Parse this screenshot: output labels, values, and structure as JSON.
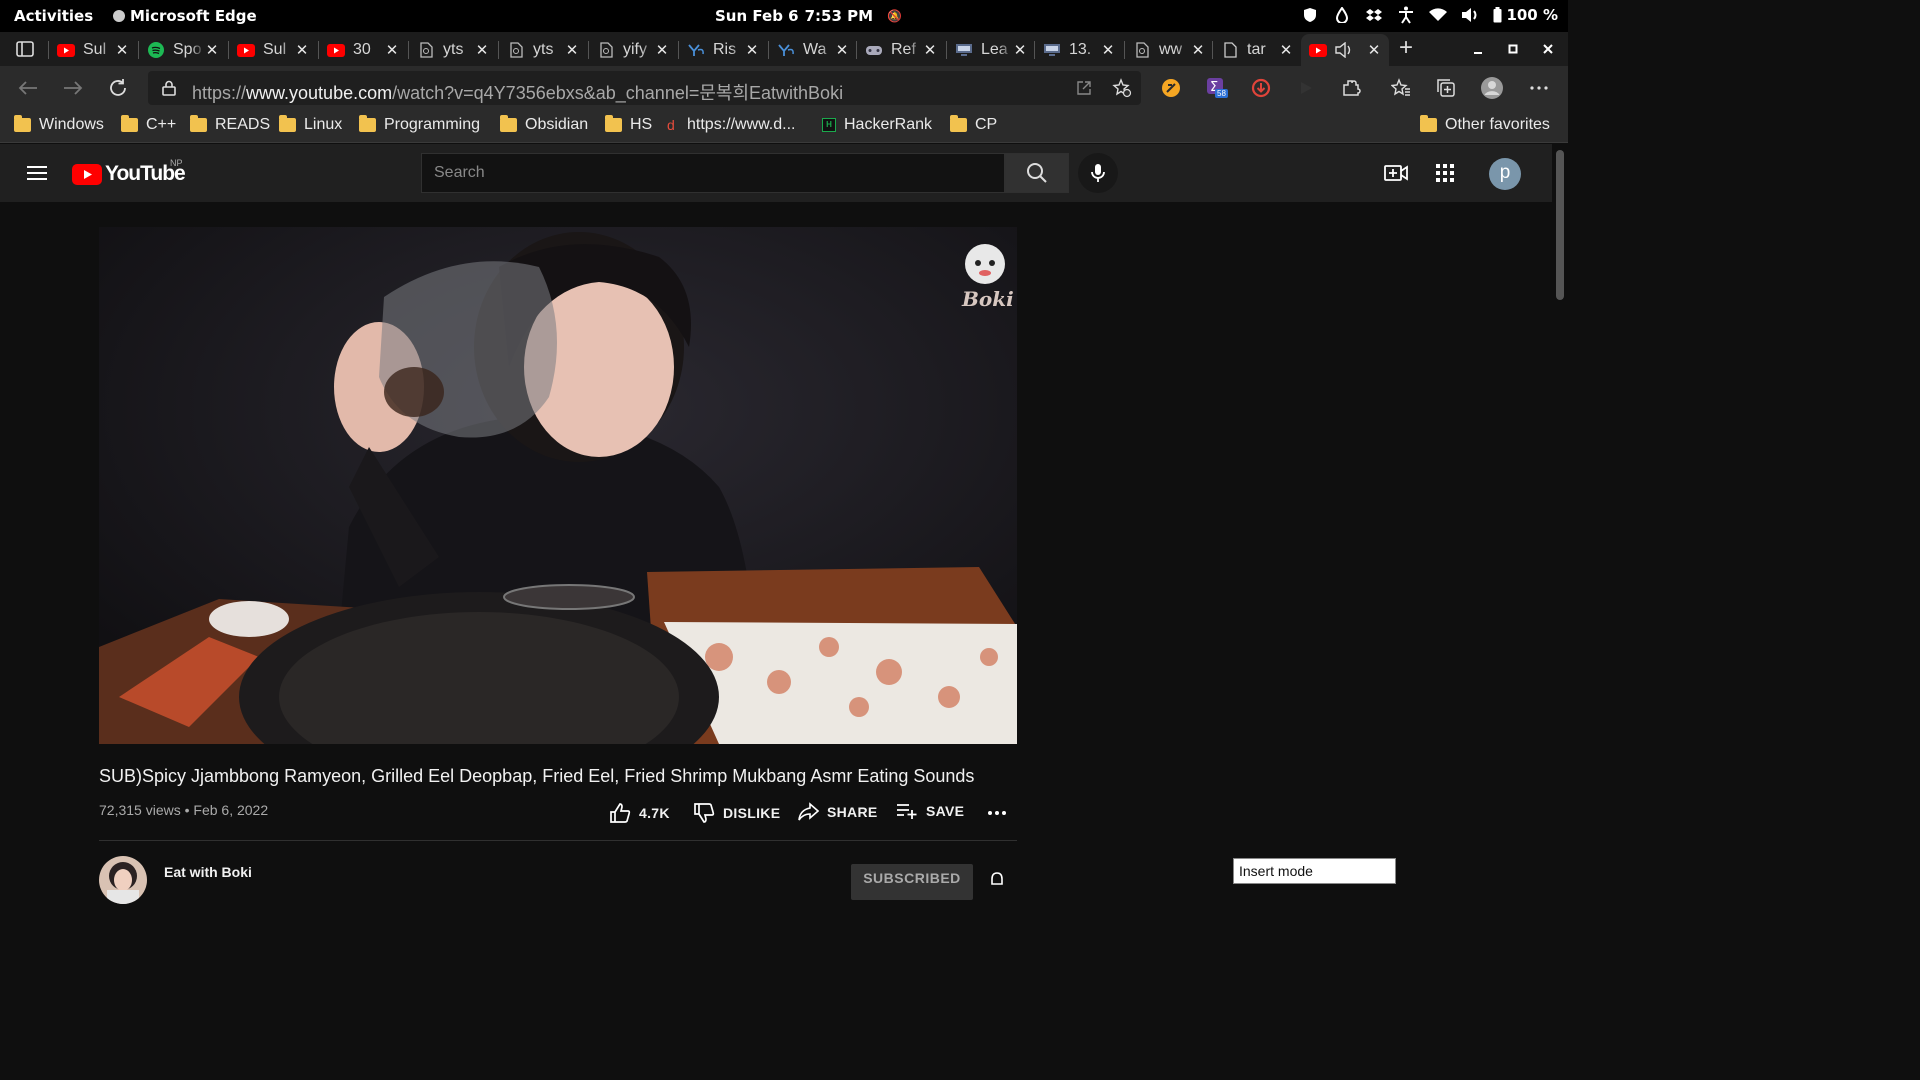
{
  "gnome": {
    "activities": "Activities",
    "app_name": "Microsoft Edge",
    "date": "Sun Feb 6",
    "time": "7:53 PM",
    "battery": "100 %"
  },
  "tabs": [
    {
      "label": "Sul",
      "favicon": "youtube-icon"
    },
    {
      "label": "Spo",
      "favicon": "spotify-icon"
    },
    {
      "label": "Sul",
      "favicon": "youtube-icon"
    },
    {
      "label": "30",
      "favicon": "youtube-icon"
    },
    {
      "label": "yts",
      "favicon": "page-icon"
    },
    {
      "label": "yts",
      "favicon": "page-icon"
    },
    {
      "label": "yify",
      "favicon": "page-icon"
    },
    {
      "label": "Ris",
      "favicon": "yc-icon"
    },
    {
      "label": "Wa",
      "favicon": "yc-icon"
    },
    {
      "label": "Ref",
      "favicon": "gamepad-icon"
    },
    {
      "label": "Lea",
      "favicon": "monitor-icon"
    },
    {
      "label": "13.",
      "favicon": "monitor-icon"
    },
    {
      "label": "ww",
      "favicon": "page-icon"
    },
    {
      "label": "tar",
      "favicon": "document-icon"
    }
  ],
  "address_bar": {
    "url_prefix": "https://",
    "url_domain": "www.youtube.com",
    "url_path": "/watch?v=q4Y7356ebxs&ab_channel=문복희EatwithBoki",
    "extension_badge": "58"
  },
  "bookmarks": [
    {
      "label": "Windows",
      "icon": "folder-icon"
    },
    {
      "label": "C++",
      "icon": "folder-icon"
    },
    {
      "label": "READS",
      "icon": "folder-icon"
    },
    {
      "label": "Linux",
      "icon": "folder-icon"
    },
    {
      "label": "Programming",
      "icon": "folder-icon"
    },
    {
      "label": "Obsidian",
      "icon": "folder-icon"
    },
    {
      "label": "HS",
      "icon": "folder-icon"
    },
    {
      "label": "https://www.d...",
      "icon": "link-icon"
    },
    {
      "label": "HackerRank",
      "icon": "hackerrank-icon"
    },
    {
      "label": "CP",
      "icon": "folder-icon"
    }
  ],
  "other_favorites": "Other favorites",
  "youtube": {
    "logo_text": "YouTube",
    "country_code": "NP",
    "search_placeholder": "Search",
    "avatar_letter": "p",
    "video_watermark": "Boki",
    "video_title": "SUB)Spicy Jjambbong Ramyeon, Grilled Eel Deopbap, Fried Eel, Fried Shrimp Mukbang Asmr Eating Sounds",
    "views_date": "72,315 views • Feb 6, 2022",
    "likes": "4.7K",
    "dislike_label": "DISLIKE",
    "share_label": "SHARE",
    "save_label": "SAVE",
    "channel_name": "Eat with Boki",
    "subscribe_label": "SUBSCRIBED"
  },
  "status": {
    "insert_mode": "Insert mode"
  },
  "colors": {
    "youtube_red": "#ff0000",
    "folder_yellow": "#f2c24f",
    "page_bg": "#0f0f0f"
  }
}
